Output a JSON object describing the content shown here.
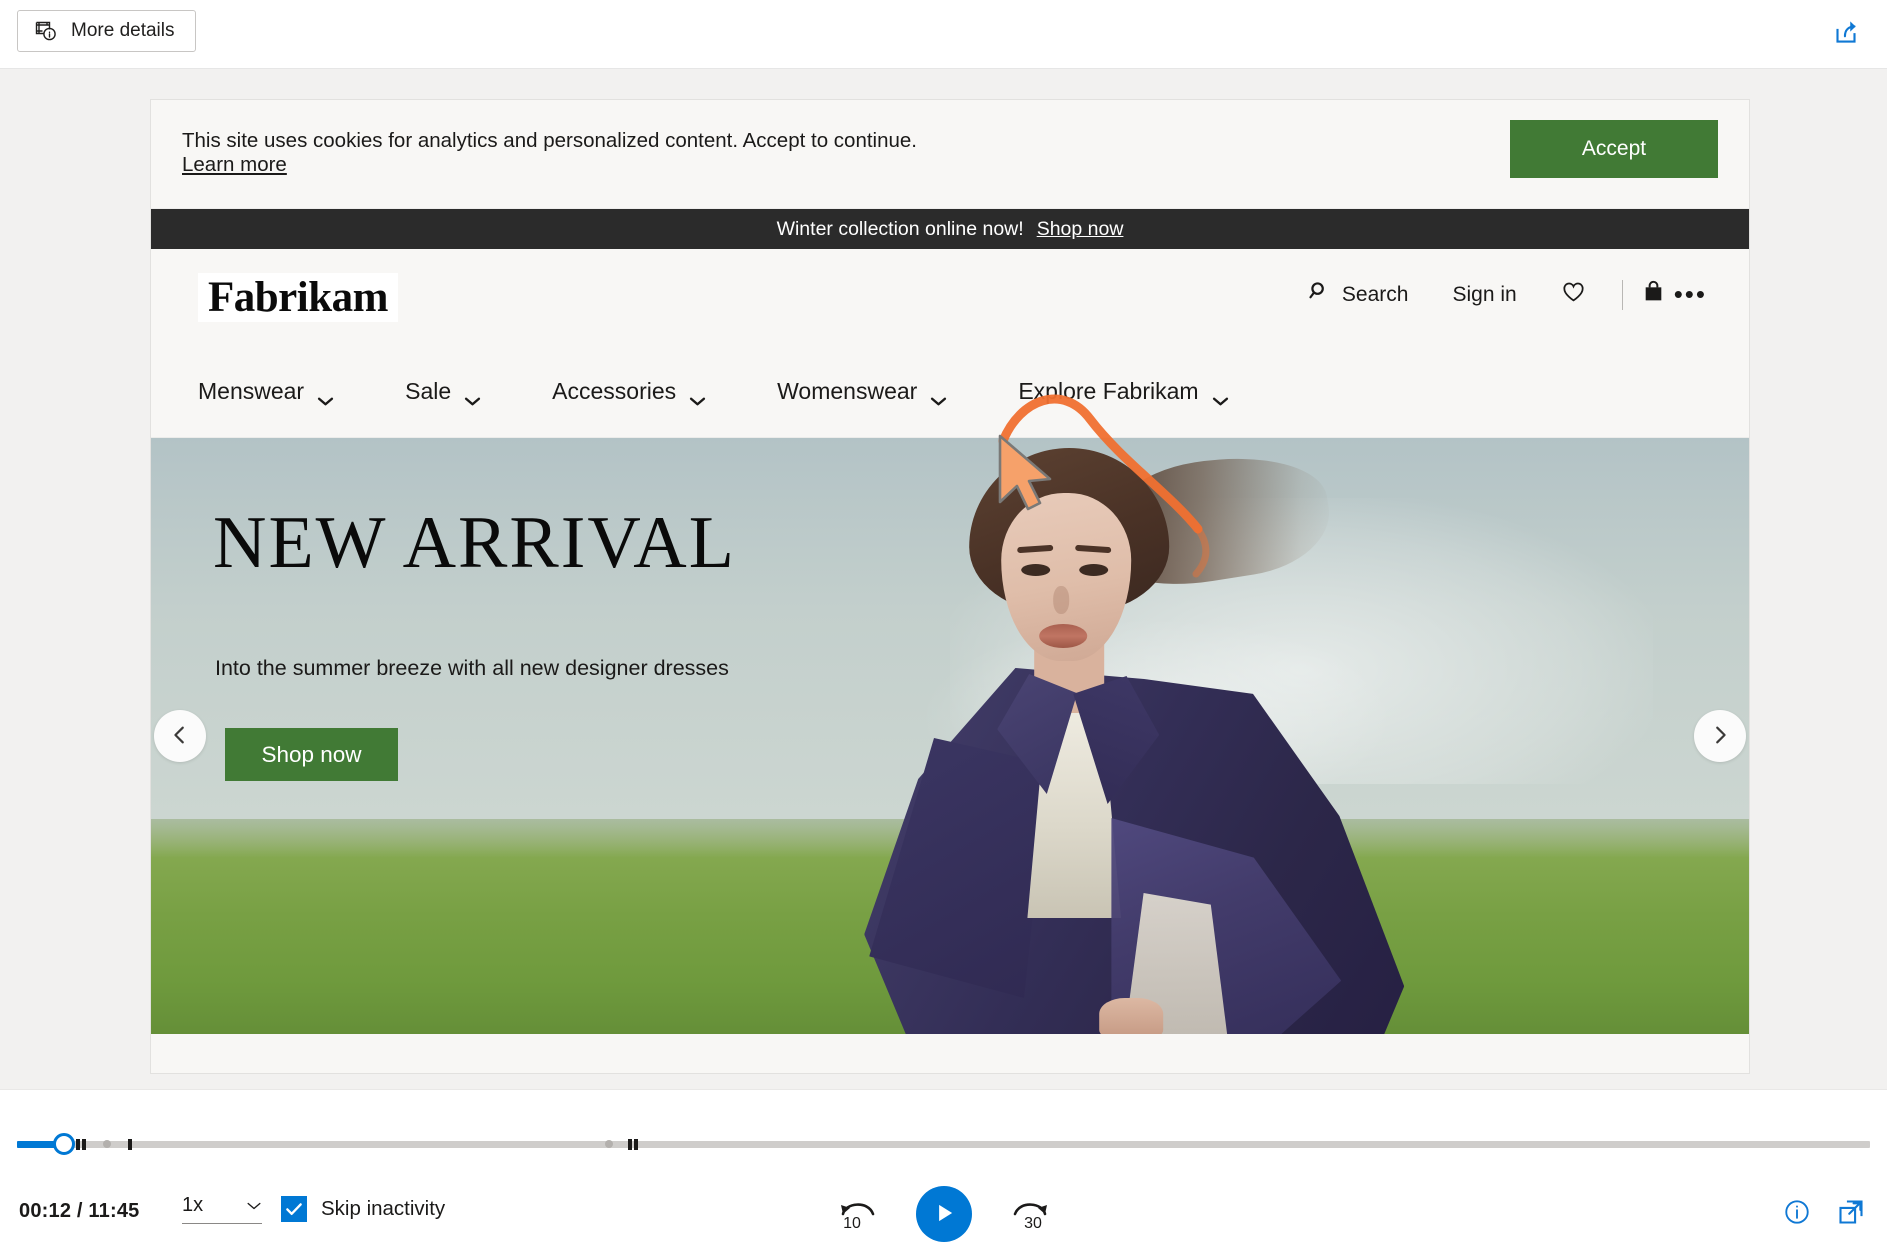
{
  "topbar": {
    "more_details_label": "More details",
    "more_details_icon": "film-info-icon",
    "share_icon": "share-icon"
  },
  "site": {
    "cookie_banner": {
      "message": "This site uses cookies for analytics and personalized content. Accept to continue.",
      "learn_more_label": "Learn more",
      "accept_label": "Accept",
      "accept_color": "#417a35"
    },
    "promo_bar": {
      "text": "Winter collection online now!",
      "link_label": "Shop now",
      "background": "#2b2b2b"
    },
    "header": {
      "logo": "Fabrikam",
      "search_label": "Search",
      "search_icon": "search-icon",
      "signin_label": "Sign in",
      "wishlist_icon": "heart-icon",
      "bag_icon": "shopping-bag-icon",
      "overflow_icon": "ellipsis-icon"
    },
    "nav": {
      "items": [
        {
          "label": "Menswear",
          "icon": "chevron-down-icon"
        },
        {
          "label": "Sale",
          "icon": "chevron-down-icon"
        },
        {
          "label": "Accessories",
          "icon": "chevron-down-icon"
        },
        {
          "label": "Womenswear",
          "icon": "chevron-down-icon"
        },
        {
          "label": "Explore Fabrikam",
          "icon": "chevron-down-icon"
        }
      ]
    },
    "hero": {
      "title": "NEW ARRIVAL",
      "subtitle": "Into the summer breeze with all new designer dresses",
      "cta_label": "Shop now",
      "cta_color": "#417a35",
      "prev_icon": "chevron-left-icon",
      "next_icon": "chevron-right-icon"
    }
  },
  "annotation": {
    "cursor_icon": "mouse-cursor-icon",
    "trail_color": "#f07030"
  },
  "player": {
    "current_time": "00:12",
    "total_time": "11:45",
    "time_display": "00:12 / 11:45",
    "speed_label": "1x",
    "speed_icon": "chevron-down-icon",
    "skip_inactivity_label": "Skip inactivity",
    "skip_inactivity_checked": true,
    "rewind_label": "10",
    "rewind_icon": "rewind-10-icon",
    "play_icon": "play-icon",
    "forward_label": "30",
    "forward_icon": "forward-30-icon",
    "info_icon": "info-icon",
    "popout_icon": "pop-out-icon",
    "accent_color": "#0078d4"
  }
}
